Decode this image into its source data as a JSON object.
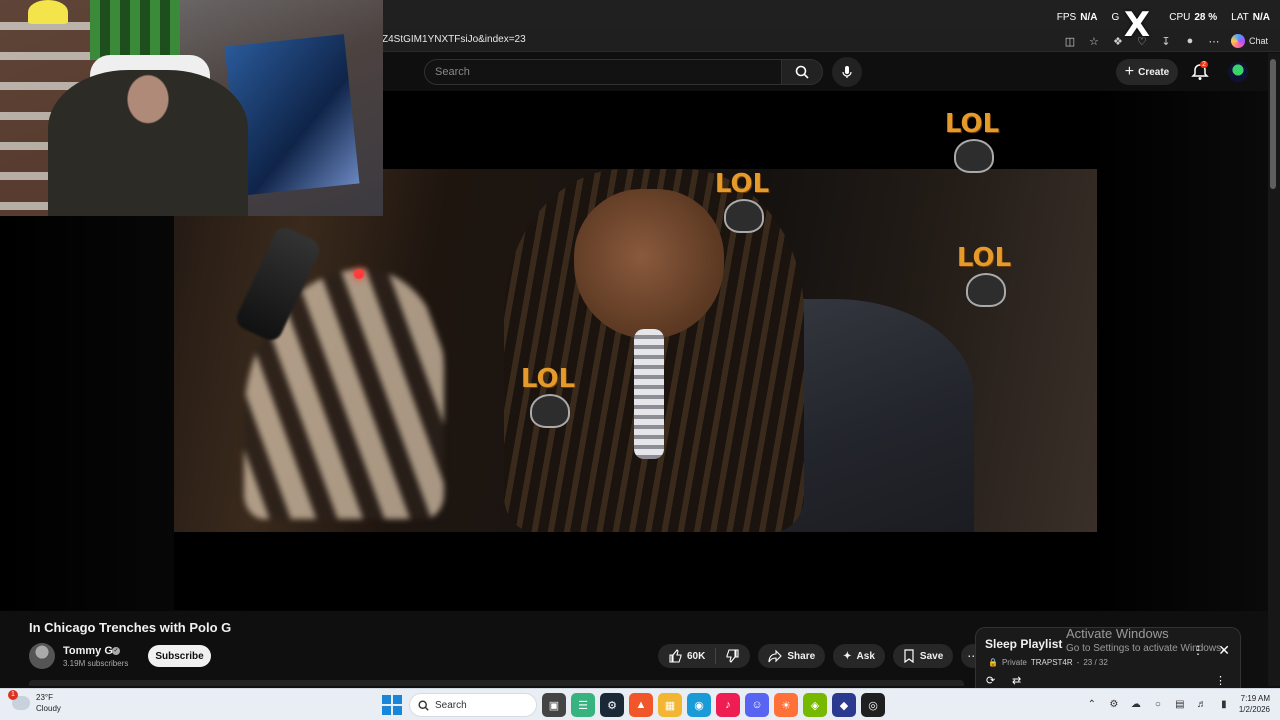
{
  "browser": {
    "url_fragment": "Z4StGIM1YNXTFsiJo&index=23",
    "chat_label": "Chat"
  },
  "stats": {
    "fps_label": "FPS",
    "fps_value": "N/A",
    "gpu_label": "G",
    "cpu_label": "CPU",
    "cpu_value": "28 %",
    "lat_label": "LAT",
    "lat_value": "N/A"
  },
  "header": {
    "search_placeholder": "Search",
    "create_label": "Create",
    "notification_count": "2"
  },
  "watermark": {
    "text": "LOL"
  },
  "video": {
    "title": "In Chicago Trenches with Polo G",
    "channel": "Tommy G",
    "subscribers": "3.19M subscribers",
    "subscribe_label": "Subscribe",
    "likes": "60K",
    "share_label": "Share",
    "ask_label": "Ask",
    "save_label": "Save"
  },
  "playlist": {
    "title": "Sleep Playlist",
    "privacy": "Private",
    "owner": "TRAPST4R",
    "position": "23 / 32"
  },
  "activation": {
    "title": "Activate Windows",
    "subtitle": "Go to Settings to activate Windows."
  },
  "taskbar": {
    "temperature": "23°F",
    "condition": "Cloudy",
    "weather_badge": "1",
    "search_label": "Search",
    "time": "7:19 AM",
    "date": "1/2/2026"
  }
}
